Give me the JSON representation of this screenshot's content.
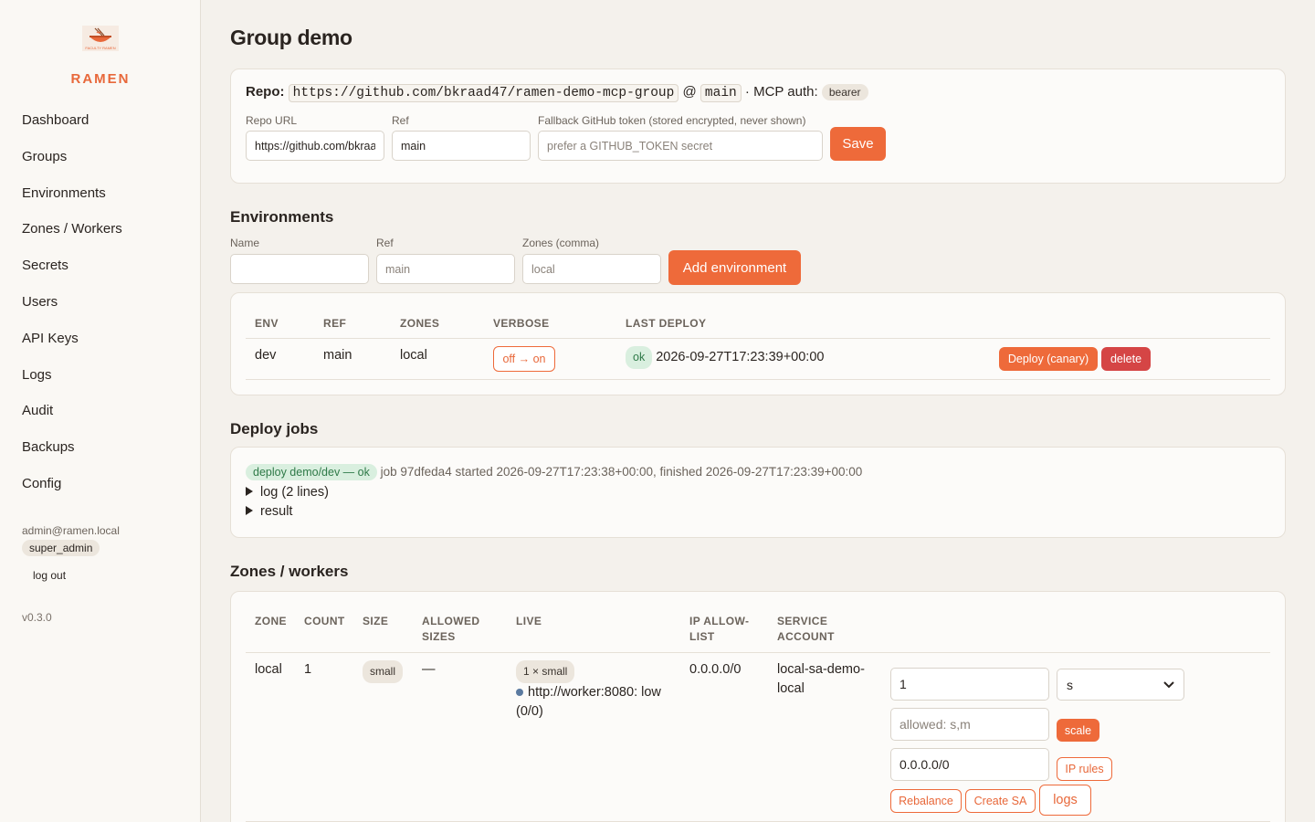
{
  "app": {
    "brand": "RAMEN",
    "version": "v0.3.0",
    "logo_text": "FACULTY RAMEN"
  },
  "sidebar": {
    "items": [
      {
        "label": "Dashboard"
      },
      {
        "label": "Groups"
      },
      {
        "label": "Environments"
      },
      {
        "label": "Zones / Workers"
      },
      {
        "label": "Secrets"
      },
      {
        "label": "Users"
      },
      {
        "label": "API Keys"
      },
      {
        "label": "Logs"
      },
      {
        "label": "Audit"
      },
      {
        "label": "Backups"
      },
      {
        "label": "Config"
      }
    ],
    "user_email": "admin@ramen.local",
    "role": "super_admin",
    "logout_label": "log out"
  },
  "page": {
    "title": "Group demo"
  },
  "repo": {
    "repo_label": "Repo:",
    "repo_url": "https://github.com/bkraad47/ramen-demo-mcp-group",
    "at": "@",
    "ref": "main",
    "auth_label": "· MCP auth:",
    "auth_value": "bearer",
    "repo_url_label": "Repo URL",
    "repo_url_value": "https://github.com/bkraad47/ramen-demo-mcp-group",
    "ref_label": "Ref",
    "ref_value": "main",
    "token_label": "Fallback GitHub token (stored encrypted, never shown)",
    "token_placeholder": "prefer a GITHUB_TOKEN secret",
    "save_label": "Save"
  },
  "environments": {
    "heading": "Environments",
    "name_label": "Name",
    "name_value": "",
    "ref_label": "Ref",
    "ref_placeholder": "main",
    "zones_label": "Zones (comma)",
    "zones_placeholder": "local",
    "add_label": "Add environment",
    "columns": [
      "ENV",
      "REF",
      "ZONES",
      "VERBOSE",
      "LAST DEPLOY"
    ],
    "rows": [
      {
        "env": "dev",
        "ref": "main",
        "zones": "local",
        "verbose": "off → on",
        "status": "ok",
        "last_deploy": "2026-09-27T17:23:39+00:00",
        "deploy_label": "Deploy (canary)",
        "delete_label": "delete"
      }
    ]
  },
  "deploy_jobs": {
    "heading": "Deploy jobs",
    "badge": "deploy demo/dev — ok",
    "description": "job 97dfeda4 started 2026-09-27T17:23:38+00:00, finished 2026-09-27T17:23:39+00:00",
    "log_label": "log (2 lines)",
    "result_label": "result"
  },
  "zones": {
    "heading": "Zones / workers",
    "columns": {
      "zone": "ZONE",
      "count": "COUNT",
      "size": "SIZE",
      "allowed_1": "ALLOWED",
      "allowed_2": "SIZES",
      "live": "LIVE",
      "ip_1": "IP ALLOW-",
      "ip_2": "LIST",
      "sa_1": "SERVICE",
      "sa_2": "ACCOUNT"
    },
    "rows": [
      {
        "zone": "local",
        "count": "1",
        "size": "small",
        "allowed_sizes": "—",
        "live_badge": "1 × small",
        "live_worker_1": "http://worker:8080: low",
        "live_worker_2": "(0/0)",
        "ip_allowlist": "0.0.0.0/0",
        "service_account_1": "local-sa-demo-",
        "service_account_2": "local",
        "count_input": "1",
        "size_select": "s",
        "allowed_placeholder": "allowed: s,m",
        "scale_label": "scale",
        "ip_input": "0.0.0.0/0",
        "ip_rules_label": "IP rules",
        "rebalance_label": "Rebalance",
        "create_sa_label": "Create SA",
        "logs_label": "logs"
      }
    ]
  },
  "colors": {
    "accent": "#ee6a3a",
    "danger": "#d54545",
    "ok": "#2f7a48"
  }
}
